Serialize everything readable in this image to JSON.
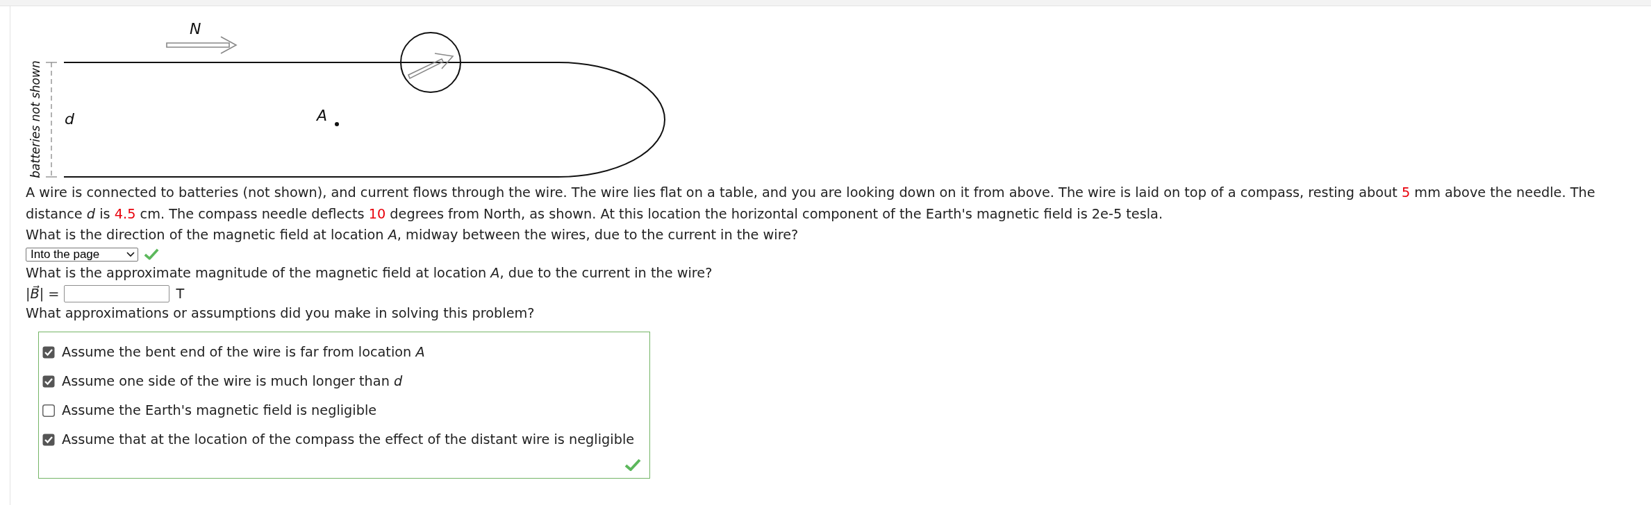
{
  "diagram": {
    "north_label": "N",
    "side_label": "batteries not shown",
    "distance_label": "d",
    "point_label": "A"
  },
  "problem_text": [
    {
      "kind": "plain",
      "text": "A wire is connected to batteries (not shown), and current flows through the wire. The wire lies flat on a table, and you are looking down on it from above. The wire is laid on top of a compass, resting about "
    },
    {
      "kind": "value",
      "text": "5"
    },
    {
      "kind": "plain",
      "text": " mm above the needle. The distance *d* is "
    },
    {
      "kind": "value",
      "text": "4.5"
    },
    {
      "kind": "plain",
      "text": " cm. The compass needle deflects "
    },
    {
      "kind": "value",
      "text": "10"
    },
    {
      "kind": "plain",
      "text": " degrees from North, as shown. At this location the horizontal component of the Earth's magnetic field is 2e-5 tesla."
    }
  ],
  "question_1": "What is the direction of the magnetic field at location *A*, midway between the wires, due to the current in the wire?",
  "direction_select": {
    "value": "Into the page",
    "correct": true
  },
  "question_2": "What is the approximate magnitude of the magnetic field at location *A*, due to the current in the wire?",
  "magnitude_field": {
    "label": "|*B⃗*| =",
    "unit": "T"
  },
  "question_3": "What approximations or assumptions did you make in solving this problem?",
  "assumptions": {
    "correct": true,
    "items": [
      {
        "text": "Assume the bent end of the wire is far from location *A*",
        "checked": true
      },
      {
        "text": "Assume one side of the wire is much longer than *d*",
        "checked": true
      },
      {
        "text": "Assume the Earth's magnetic field is negligible",
        "checked": false
      },
      {
        "text": "Assume that at the location of the compass the effect of the distant wire is negligible",
        "checked": true
      }
    ]
  }
}
